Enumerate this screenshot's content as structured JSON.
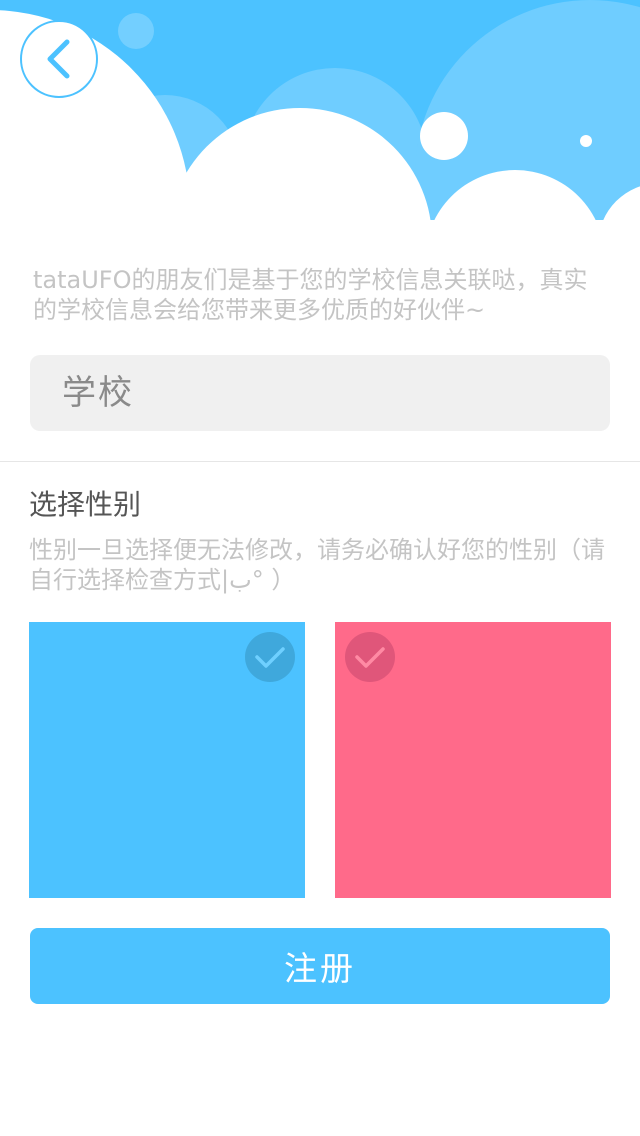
{
  "colors": {
    "sky": "#4cc2ff",
    "sky_light": "#6fcdff",
    "male": "#4cc2ff",
    "female": "#ff6a8a",
    "male_check": "#3fa8dc",
    "female_check": "#e0567a",
    "button": "#4cc2ff",
    "hint_text": "#c4c4c4"
  },
  "header": {
    "back_icon": "chevron-left-icon"
  },
  "intro": {
    "text": "tataUFO的朋友们是基于您的学校信息关联哒，真实的学校信息会给您带来更多优质的好伙伴~"
  },
  "school": {
    "placeholder": "学校",
    "value": ""
  },
  "gender": {
    "title": "选择性别",
    "note": "性别一旦选择便无法修改，请务必确认好您的性别（请自行选择检查方式|ب° ）",
    "options": [
      {
        "key": "male",
        "check_icon": "checkmark-icon",
        "selected": false
      },
      {
        "key": "female",
        "check_icon": "checkmark-icon",
        "selected": false
      }
    ]
  },
  "actions": {
    "register_label": "注册"
  }
}
